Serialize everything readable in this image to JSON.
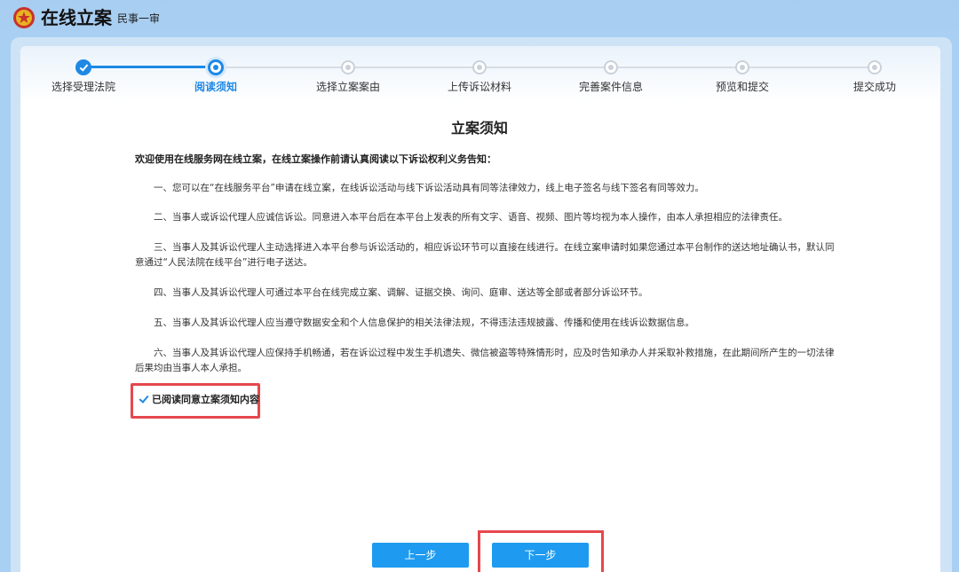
{
  "header": {
    "app_title": "在线立案",
    "subtitle": "民事一审",
    "emblem_icon": "court-emblem-icon"
  },
  "steps": [
    {
      "label": "选择受理法院",
      "state": "done"
    },
    {
      "label": "阅读须知",
      "state": "current"
    },
    {
      "label": "选择立案案由",
      "state": "pending"
    },
    {
      "label": "上传诉讼材料",
      "state": "pending"
    },
    {
      "label": "完善案件信息",
      "state": "pending"
    },
    {
      "label": "预览和提交",
      "state": "pending"
    },
    {
      "label": "提交成功",
      "state": "pending"
    }
  ],
  "notice": {
    "title": "立案须知",
    "intro": "欢迎使用在线服务网在线立案，在线立案操作前请认真阅读以下诉讼权利义务告知：",
    "paragraphs": [
      "一、您可以在“在线服务平台”申请在线立案，在线诉讼活动与线下诉讼活动具有同等法律效力，线上电子签名与线下签名有同等效力。",
      "二、当事人或诉讼代理人应诚信诉讼。同意进入本平台后在本平台上发表的所有文字、语音、视频、图片等均视为本人操作，由本人承担相应的法律责任。",
      "三、当事人及其诉讼代理人主动选择进入本平台参与诉讼活动的，相应诉讼环节可以直接在线进行。在线立案申请时如果您通过本平台制作的送达地址确认书，默认同意通过“人民法院在线平台”进行电子送达。",
      "四、当事人及其诉讼代理人可通过本平台在线完成立案、调解、证据交换、询问、庭审、送达等全部或者部分诉讼环节。",
      "五、当事人及其诉讼代理人应当遵守数据安全和个人信息保护的相关法律法规，不得违法违规披露、传播和使用在线诉讼数据信息。",
      "六、当事人及其诉讼代理人应保持手机畅通，若在诉讼过程中发生手机遗失、微信被盗等特殊情形时，应及时告知承办人并采取补救措施，在此期间所产生的一切法律后果均由当事人本人承担。"
    ],
    "agree_label": "已阅读同意立案须知内容",
    "agree_checked": true
  },
  "buttons": {
    "prev_label": "上一步",
    "next_label": "下一步"
  },
  "colors": {
    "accent": "#1e88e5",
    "button": "#1e9bf0",
    "highlight": "#e5484d",
    "background": "#a9cff2"
  }
}
